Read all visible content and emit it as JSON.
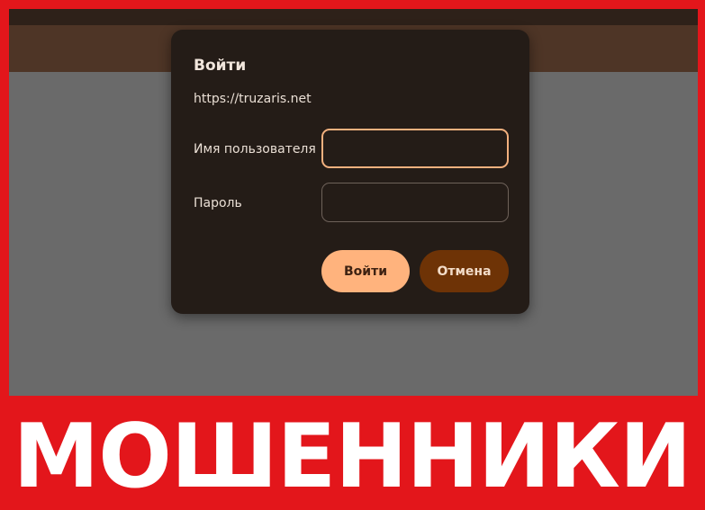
{
  "dialog": {
    "title": "Войти",
    "url": "https://truzaris.net",
    "username_label": "Имя пользователя",
    "username_value": "",
    "password_label": "Пароль",
    "password_value": "",
    "login_button": "Войти",
    "cancel_button": "Отмена"
  },
  "banner": {
    "text": "МОШЕННИКИ"
  },
  "colors": {
    "frame_red": "#e3161b",
    "dialog_bg": "#241c17",
    "accent_peach": "#ffb37d",
    "cancel_brown": "#6e3306"
  }
}
